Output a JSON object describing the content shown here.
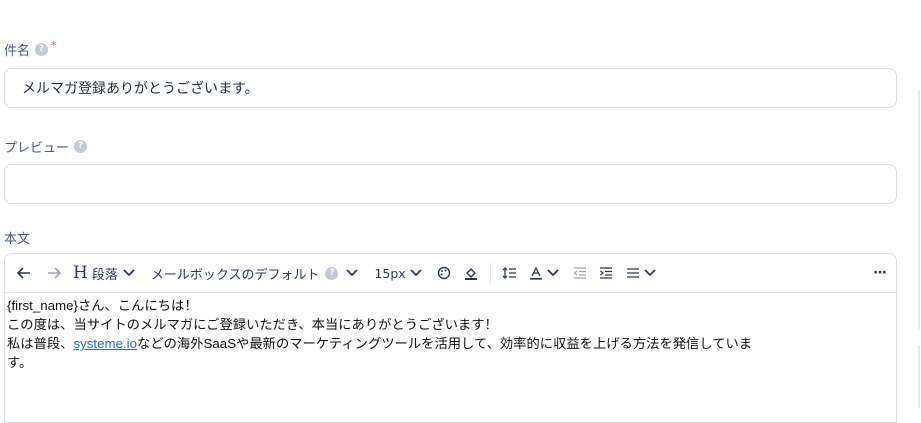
{
  "subject": {
    "label": "件名",
    "required_mark": "*",
    "value": "メルマガ登録ありがとうございます。"
  },
  "preview": {
    "label": "プレビュー",
    "value": ""
  },
  "body": {
    "label": "本文",
    "toolbar": {
      "heading_label": "段落",
      "font_label": "メールボックスのデフォルト",
      "size_label": "15px",
      "more_label": "···"
    },
    "content": {
      "line1": "{first_name}さん、こんにちは！",
      "line2": "この度は、当サイトのメルマガにご登録いただき、本当にありがとうございます！",
      "line3_prefix": "私は普段、",
      "line3_link": "systeme.io",
      "line3_suffix": "などの海外SaaSや最新のマーケティングツールを活用して、効率的に収益を上げる方法を発信していま",
      "line4": "す。"
    }
  },
  "icons": {
    "help": "help-circle-icon",
    "undo": "undo-arrow-icon",
    "redo": "redo-arrow-icon",
    "heading": "heading-icon",
    "chevron": "chevron-down-icon",
    "palette": "palette-icon",
    "highlight": "highlight-bucket-icon",
    "line_height": "line-height-icon",
    "text_color": "text-color-icon",
    "outdent": "outdent-icon",
    "indent": "indent-icon",
    "align": "align-left-icon",
    "more": "more-dots-icon"
  },
  "colors": {
    "label": "#4a5a78",
    "border": "#d8dde6",
    "link": "#1a6dd1",
    "required": "#e5484d"
  }
}
